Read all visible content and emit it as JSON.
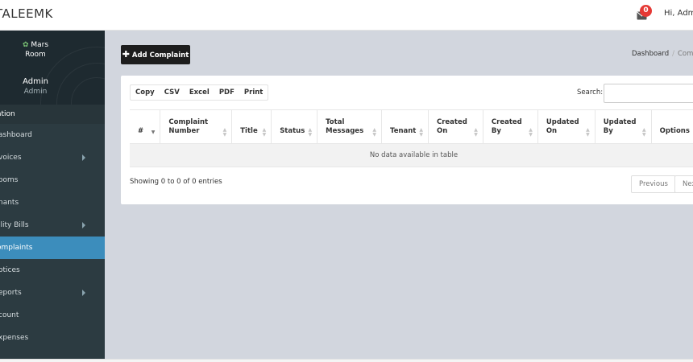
{
  "app": {
    "brand": "TALEEMK",
    "greeting": "Hi, Admin"
  },
  "notifications": {
    "count": "0"
  },
  "profile": {
    "org_line1": "Mars",
    "org_line2": "Room",
    "name": "Admin",
    "role": "Admin"
  },
  "sidebar": {
    "header": "ation",
    "items": [
      {
        "label": "ashboard",
        "has_submenu": false,
        "active": false
      },
      {
        "label": "voices",
        "has_submenu": true,
        "active": false
      },
      {
        "label": "ooms",
        "has_submenu": false,
        "active": false
      },
      {
        "label": "nants",
        "has_submenu": false,
        "active": false
      },
      {
        "label": "ility Bills",
        "has_submenu": true,
        "active": false
      },
      {
        "label": "omplaints",
        "has_submenu": false,
        "active": true
      },
      {
        "label": "otices",
        "has_submenu": false,
        "active": false
      },
      {
        "label": "eports",
        "has_submenu": true,
        "active": false
      },
      {
        "label": "count",
        "has_submenu": false,
        "active": false
      },
      {
        "label": "xpenses",
        "has_submenu": false,
        "active": false
      }
    ]
  },
  "toolbar": {
    "add_label": "Add Complaint"
  },
  "breadcrumb": {
    "home": "Dashboard",
    "current": "Comp"
  },
  "table": {
    "export_buttons": [
      "Copy",
      "CSV",
      "Excel",
      "PDF",
      "Print"
    ],
    "search_label": "Search:",
    "search_value": "",
    "columns": [
      {
        "line1": "#",
        "line2": ""
      },
      {
        "line1": "Complaint",
        "line2": "Number"
      },
      {
        "line1": "Title",
        "line2": ""
      },
      {
        "line1": "Status",
        "line2": ""
      },
      {
        "line1": "Total",
        "line2": "Messages"
      },
      {
        "line1": "Tenant",
        "line2": ""
      },
      {
        "line1": "Created",
        "line2": "On"
      },
      {
        "line1": "Created",
        "line2": "By"
      },
      {
        "line1": "Updated",
        "line2": "On"
      },
      {
        "line1": "Updated",
        "line2": "By"
      },
      {
        "line1": "Options",
        "line2": ""
      }
    ],
    "empty_message": "No data available in table",
    "info": "Showing 0 to 0 of 0 entries",
    "pagination": {
      "previous": "Previous",
      "next": "Nex"
    }
  },
  "colors": {
    "accent": "#3c8dbc",
    "sidebar": "#2c3b41",
    "badge": "#e53935",
    "content_bg": "#d2d6de"
  }
}
